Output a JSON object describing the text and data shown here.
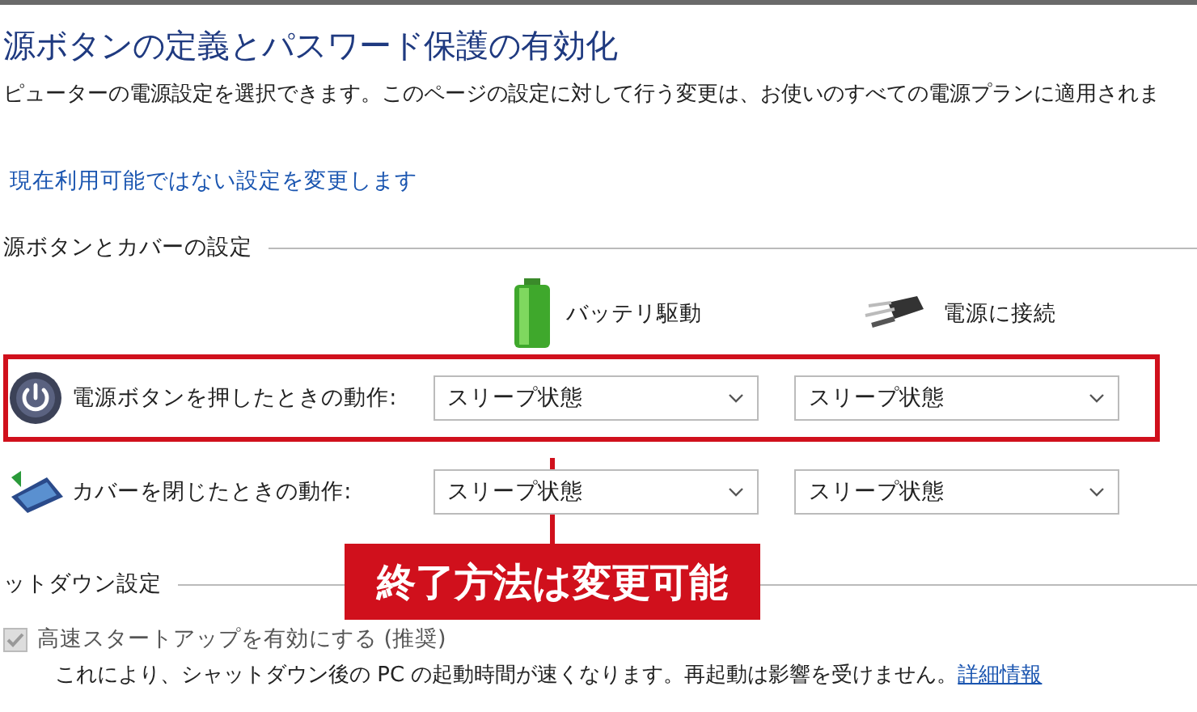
{
  "title": "源ボタンの定義とパスワード保護の有効化",
  "description": "ピューターの電源設定を選択できます。このページの設定に対して行う変更は、お使いのすべての電源プランに適用されま",
  "change_link": "現在利用可能ではない設定を変更します",
  "power_section": {
    "heading": "源ボタンとカバーの設定",
    "columns": [
      "バッテリ駆動",
      "電源に接続"
    ],
    "rows": [
      {
        "kind": "power",
        "label": "電源ボタンを押したときの動作:",
        "values": [
          "スリープ状態",
          "スリープ状態"
        ],
        "highlighted": true
      },
      {
        "kind": "lid",
        "label": "カバーを閉じたときの動作:",
        "values": [
          "スリープ状態",
          "スリープ状態"
        ],
        "highlighted": false
      }
    ]
  },
  "callout": "終了方法は変更可能",
  "shutdown_section": {
    "heading": "ットダウン設定",
    "options": [
      {
        "label": "高速スタートアップを有効にする (推奨)",
        "checked": true,
        "disabled": true,
        "note": "これにより、シャットダウン後の PC の起動時間が速くなります。再起動は影響を受けません。",
        "note_link": "詳細情報"
      }
    ]
  }
}
